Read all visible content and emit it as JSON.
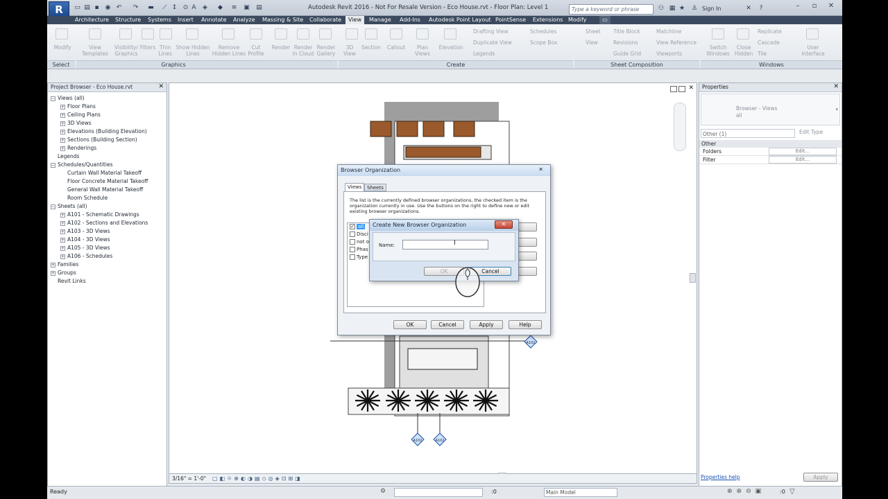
{
  "window": {
    "title": "Autodesk Revit 2016 - Not For Resale Version -    Eco House.rvt - Floor Plan: Level 1",
    "search_placeholder": "Type a keyword or phrase",
    "sign_in": "Sign In",
    "logo": "R"
  },
  "tabs": [
    "Architecture",
    "Structure",
    "Systems",
    "Insert",
    "Annotate",
    "Analyze",
    "Massing & Site",
    "Collaborate",
    "View",
    "Manage",
    "Add-Ins",
    "Autodesk Point Layout",
    "PointSense",
    "Extensions",
    "Modify"
  ],
  "active_tab": "View",
  "ribbon": {
    "select_panel": "Select",
    "modify": "Modify",
    "graphics_panel": "Graphics",
    "graphics_buttons": [
      "View Templates",
      "Visibility/ Graphics",
      "Filters",
      "Thin Lines",
      "Show Hidden Lines",
      "Remove Hidden Lines",
      "Cut Profile"
    ],
    "graphics_large": [
      "Render",
      "Render in Cloud",
      "Render Gallery"
    ],
    "create_panel": "Create",
    "create_buttons": [
      "3D View",
      "Section",
      "Callout",
      "Plan Views",
      "Elevation"
    ],
    "create_small": [
      "Drafting View",
      "Duplicate View",
      "Legends",
      "Schedules",
      "Scope Box"
    ],
    "sheet_panel": "Sheet Composition",
    "sheet_small": [
      "Sheet",
      "View",
      "Title Block",
      "Revisions",
      "Guide Grid",
      "Matchline",
      "View Reference",
      "Viewports"
    ],
    "windows_panel": "Windows",
    "windows_buttons": [
      "Switch Windows",
      "Close Hidden",
      "User Interface"
    ],
    "windows_small": [
      "Replicate",
      "Cascade",
      "Tile"
    ]
  },
  "project_browser": {
    "title": "Project Browser - Eco House.rvt",
    "items": [
      {
        "label": "Views (all)",
        "level": 0,
        "exp": "-"
      },
      {
        "label": "Floor Plans",
        "level": 1,
        "exp": "+"
      },
      {
        "label": "Ceiling Plans",
        "level": 1,
        "exp": "+"
      },
      {
        "label": "3D Views",
        "level": 1,
        "exp": "+"
      },
      {
        "label": "Elevations (Building Elevation)",
        "level": 1,
        "exp": "+"
      },
      {
        "label": "Sections (Building Section)",
        "level": 1,
        "exp": "+"
      },
      {
        "label": "Renderings",
        "level": 1,
        "exp": "+"
      },
      {
        "label": "Legends",
        "level": 0,
        "exp": ""
      },
      {
        "label": "Schedules/Quantities",
        "level": 0,
        "exp": "-"
      },
      {
        "label": "Curtain Wall Material Takeoff",
        "level": 1,
        "exp": ""
      },
      {
        "label": "Floor Concrete Material Takeoff",
        "level": 1,
        "exp": ""
      },
      {
        "label": "General Wall Material Takeoff",
        "level": 1,
        "exp": ""
      },
      {
        "label": "Room Schedule",
        "level": 1,
        "exp": ""
      },
      {
        "label": "Sheets (all)",
        "level": 0,
        "exp": "-"
      },
      {
        "label": "A101 - Schematic Drawings",
        "level": 1,
        "exp": "+"
      },
      {
        "label": "A102 - Sections and Elevations",
        "level": 1,
        "exp": "+"
      },
      {
        "label": "A103 - 3D Views",
        "level": 1,
        "exp": "+"
      },
      {
        "label": "A104 - 3D Views",
        "level": 1,
        "exp": "+"
      },
      {
        "label": "A105 - 3D Views",
        "level": 1,
        "exp": "+"
      },
      {
        "label": "A106 - Schedules",
        "level": 1,
        "exp": "+"
      },
      {
        "label": "Families",
        "level": 0,
        "exp": "+"
      },
      {
        "label": "Groups",
        "level": 0,
        "exp": "+"
      },
      {
        "label": "Revit Links",
        "level": 0,
        "exp": ""
      }
    ]
  },
  "properties": {
    "title": "Properties",
    "type_name": "Browser - Views",
    "type_sub": "all",
    "selector": "Other (1)",
    "edit_type": "Edit Type",
    "section": "Other",
    "rows": [
      {
        "label": "Folders",
        "value": "Edit..."
      },
      {
        "label": "Filter",
        "value": "Edit..."
      }
    ],
    "help": "Properties help",
    "apply": "Apply"
  },
  "view_control": {
    "scale": "3/16\" = 1'-0\""
  },
  "status": {
    "text": "Ready",
    "coord": ":0",
    "model": "Main Model",
    "filter": ":0"
  },
  "browser_org_dialog": {
    "title": "Browser Organization",
    "tabs": [
      "Views",
      "Sheets"
    ],
    "description": "The list is the currently defined browser organizations,  the checked item is the organization currently in use. Use the buttons on the right to define new or edit existing browser organizations.",
    "list": [
      {
        "label": "all",
        "checked": true
      },
      {
        "label": "Disci",
        "checked": false
      },
      {
        "label": "not o",
        "checked": false
      },
      {
        "label": "Phas",
        "checked": false
      },
      {
        "label": "Type",
        "checked": false
      }
    ],
    "buttons": [
      "OK",
      "Cancel",
      "Apply",
      "Help"
    ]
  },
  "create_dialog": {
    "title": "Create New Browser Organization",
    "name_label": "Name:",
    "name_value": "",
    "ok": "OK",
    "cancel": "Cancel"
  },
  "plan_tags": [
    "A102",
    "A102",
    "A102"
  ],
  "colors": {
    "ribbon_tab_bg": "#3b4a5e",
    "selection": "#3399ff",
    "wood": "#9a5a2c"
  }
}
